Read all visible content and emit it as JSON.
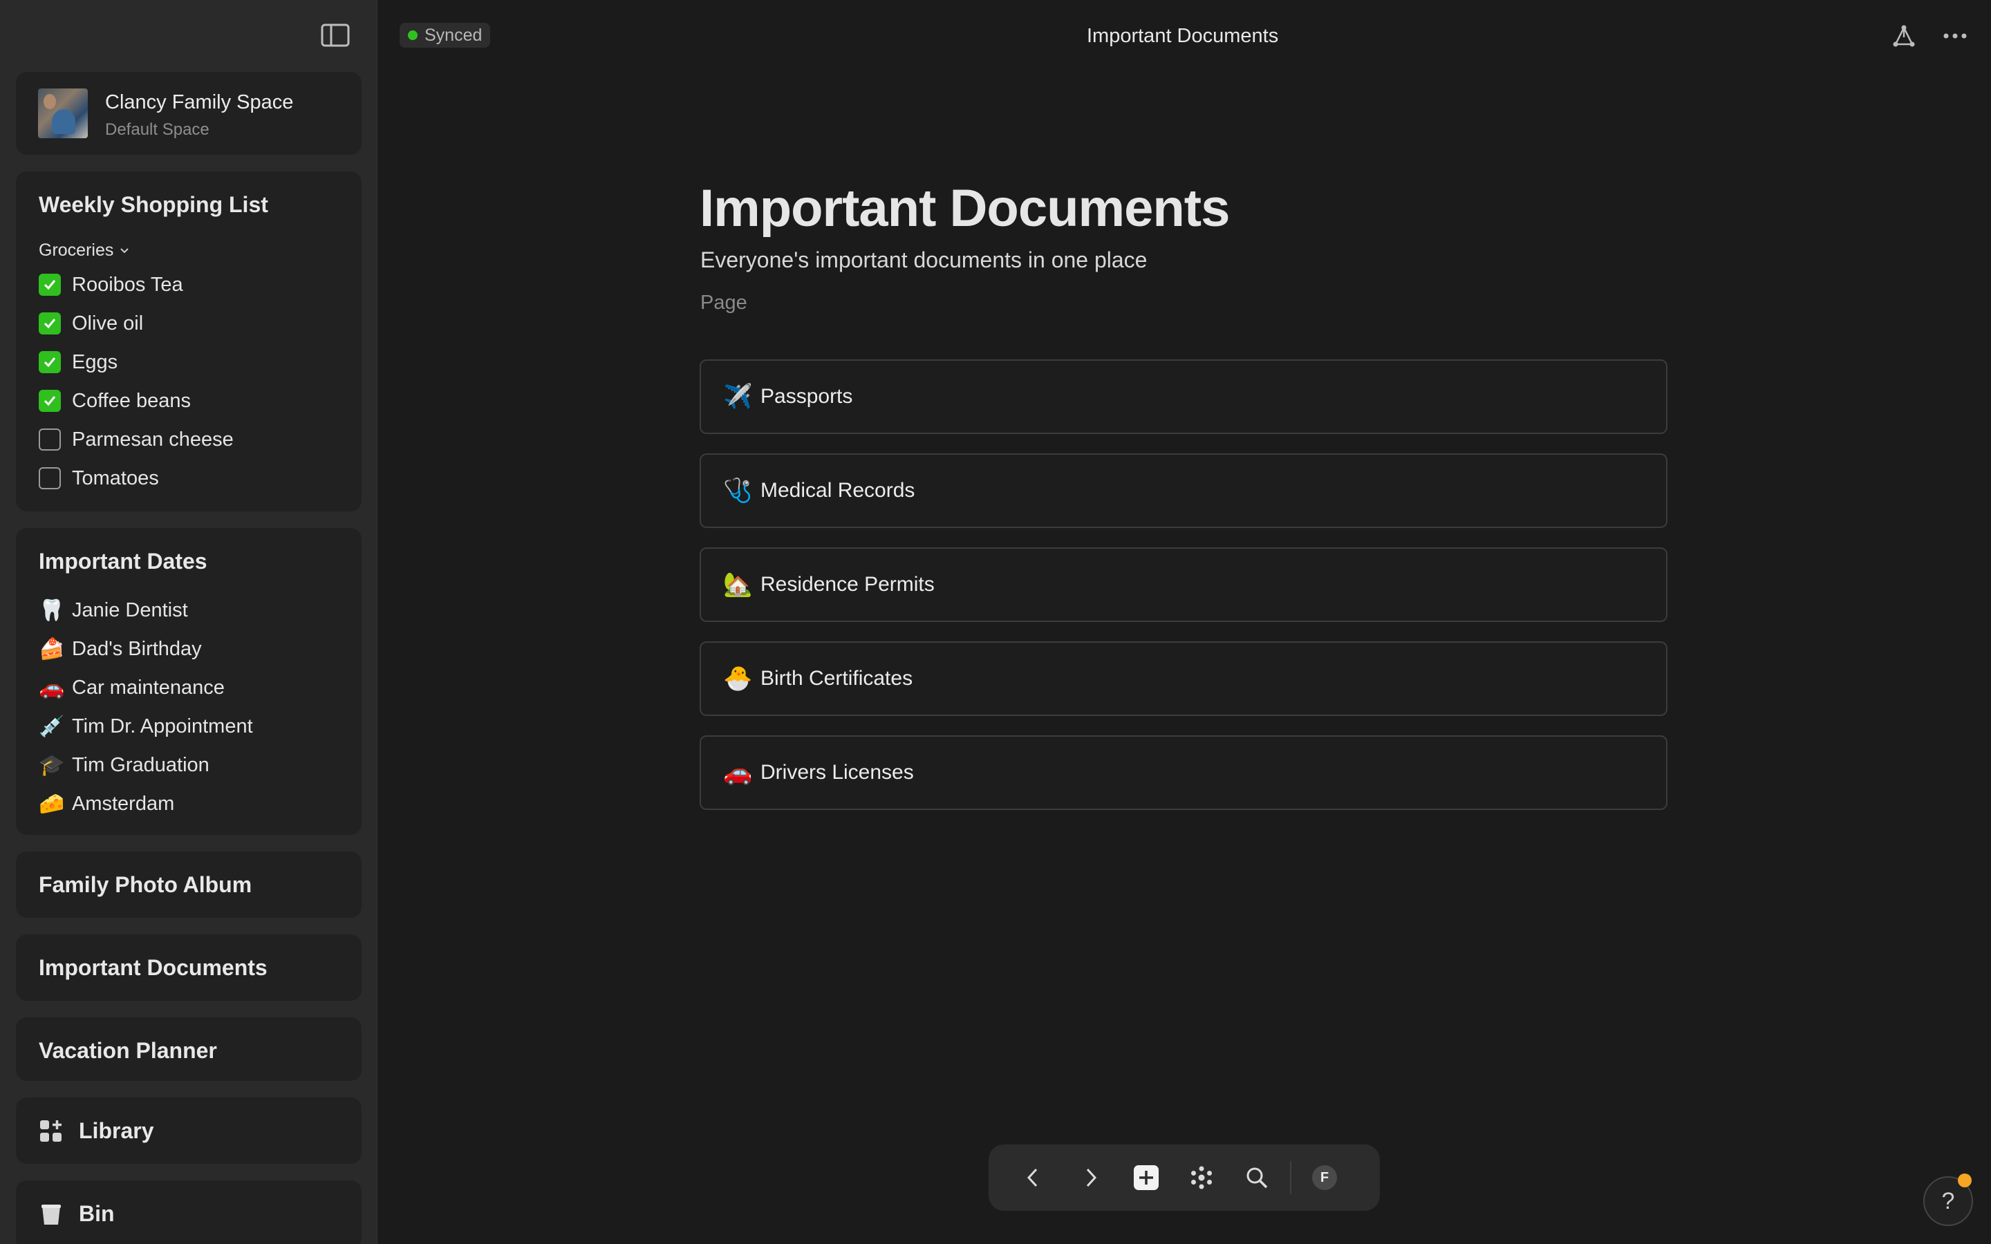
{
  "sidebar": {
    "space": {
      "name": "Clancy Family Space",
      "subtitle": "Default Space"
    },
    "shopping": {
      "title": "Weekly Shopping List",
      "group": "Groceries",
      "items": [
        {
          "label": "Rooibos Tea",
          "checked": true
        },
        {
          "label": "Olive oil",
          "checked": true
        },
        {
          "label": "Eggs",
          "checked": true
        },
        {
          "label": "Coffee beans",
          "checked": true
        },
        {
          "label": "Parmesan cheese",
          "checked": false
        },
        {
          "label": "Tomatoes",
          "checked": false
        }
      ]
    },
    "dates": {
      "title": "Important Dates",
      "items": [
        {
          "emoji": "🦷",
          "label": "Janie Dentist"
        },
        {
          "emoji": "🍰",
          "label": "Dad's Birthday"
        },
        {
          "emoji": "🚗",
          "label": "Car maintenance"
        },
        {
          "emoji": "💉",
          "label": "Tim Dr. Appointment"
        },
        {
          "emoji": "🎓",
          "label": "Tim Graduation"
        },
        {
          "emoji": "🧀",
          "label": "Amsterdam"
        }
      ]
    },
    "nav": {
      "photo_album": "Family Photo Album",
      "documents": "Important Documents",
      "vacation": "Vacation Planner",
      "library": "Library",
      "bin": "Bin"
    }
  },
  "topbar": {
    "sync_status": "Synced",
    "sync_color": "#2fc21f",
    "title": "Important Documents"
  },
  "page": {
    "title": "Important Documents",
    "subtitle": "Everyone's important documents in one place",
    "type": "Page",
    "documents": [
      {
        "emoji": "✈️",
        "label": "Passports"
      },
      {
        "emoji": "🩺",
        "label": "Medical Records"
      },
      {
        "emoji": "🏡",
        "label": "Residence Permits"
      },
      {
        "emoji": "🐣",
        "label": "Birth Certificates"
      },
      {
        "emoji": "🚗",
        "label": "Drivers Licenses"
      }
    ]
  },
  "toolbar": {
    "avatar_initial": "F",
    "icons": [
      "back-icon",
      "forward-icon",
      "add-icon",
      "graph-icon",
      "search-icon"
    ]
  },
  "help": {
    "label": "?"
  }
}
